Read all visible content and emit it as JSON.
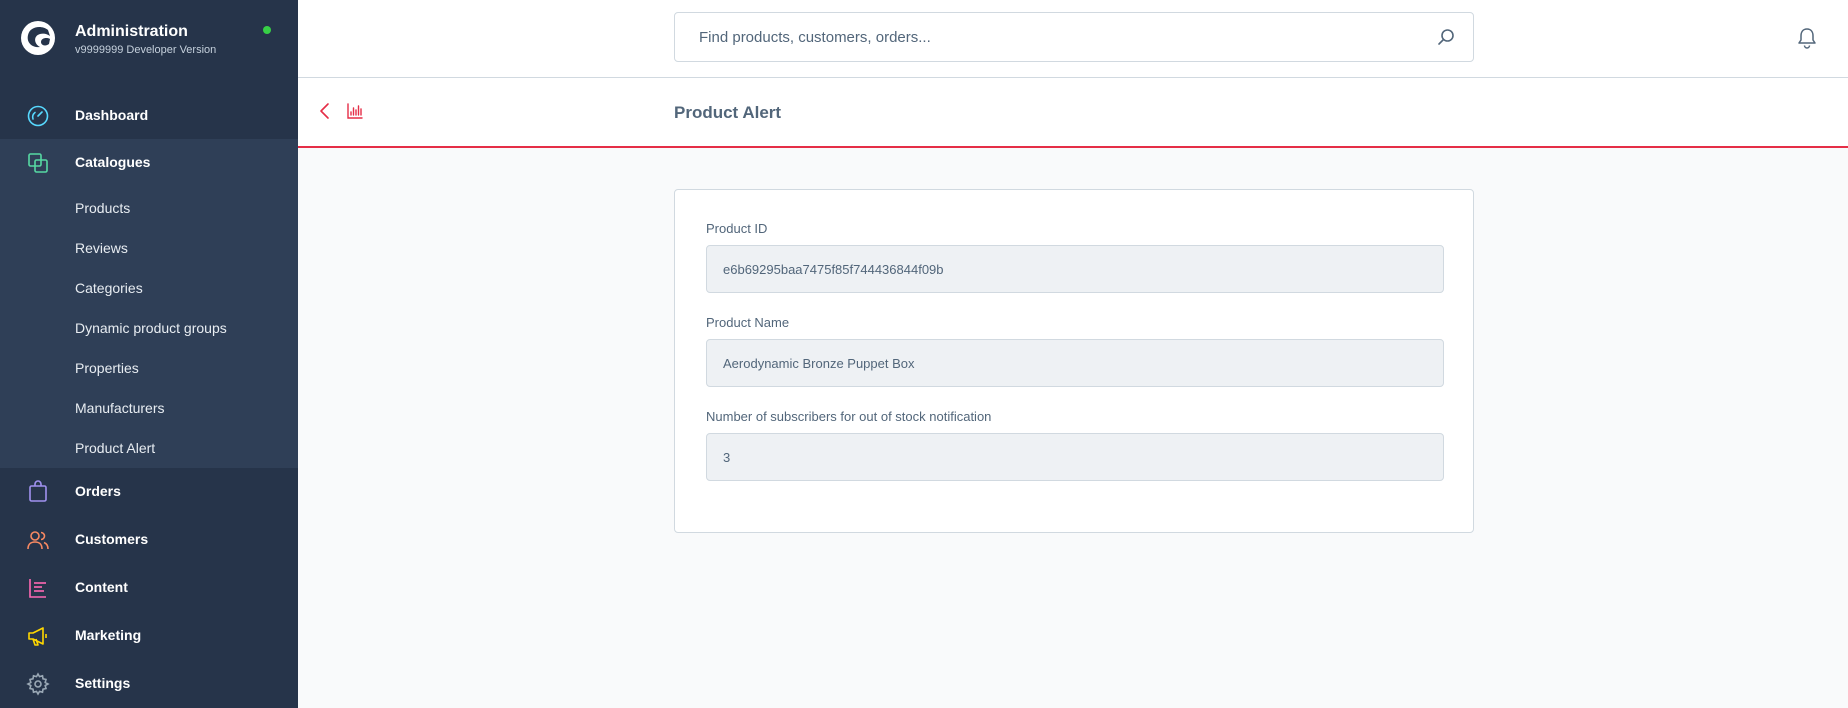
{
  "brand": {
    "title": "Administration",
    "version": "v9999999 Developer Version",
    "status_color": "#37d046"
  },
  "sidebar": {
    "items": [
      {
        "label": "Dashboard",
        "icon": "dashboard-gauge-icon",
        "color": "#57d9ff"
      },
      {
        "label": "Catalogues",
        "icon": "catalogue-stack-icon",
        "color": "#57d9a3"
      },
      {
        "label": "Orders",
        "icon": "shopping-bag-icon",
        "color": "#a092f0"
      },
      {
        "label": "Customers",
        "icon": "users-icon",
        "color": "#f88962"
      },
      {
        "label": "Content",
        "icon": "content-list-icon",
        "color": "#ff68b4"
      },
      {
        "label": "Marketing",
        "icon": "megaphone-icon",
        "color": "#ffd700"
      },
      {
        "label": "Settings",
        "icon": "gear-icon",
        "color": "#9aa8b5"
      }
    ],
    "catalogue_sub_items": [
      "Products",
      "Reviews",
      "Categories",
      "Dynamic product groups",
      "Properties",
      "Manufacturers",
      "Product Alert"
    ]
  },
  "search": {
    "placeholder": "Find products, customers, orders..."
  },
  "page": {
    "title": "Product Alert",
    "accent_color": "#e52e47"
  },
  "form": {
    "product_id_label": "Product ID",
    "product_id_value": "e6b69295baa7475f85f744436844f09b",
    "product_name_label": "Product Name",
    "product_name_value": "Aerodynamic Bronze Puppet Box",
    "subscribers_label": "Number of subscribers for out of stock notification",
    "subscribers_value": "3"
  }
}
